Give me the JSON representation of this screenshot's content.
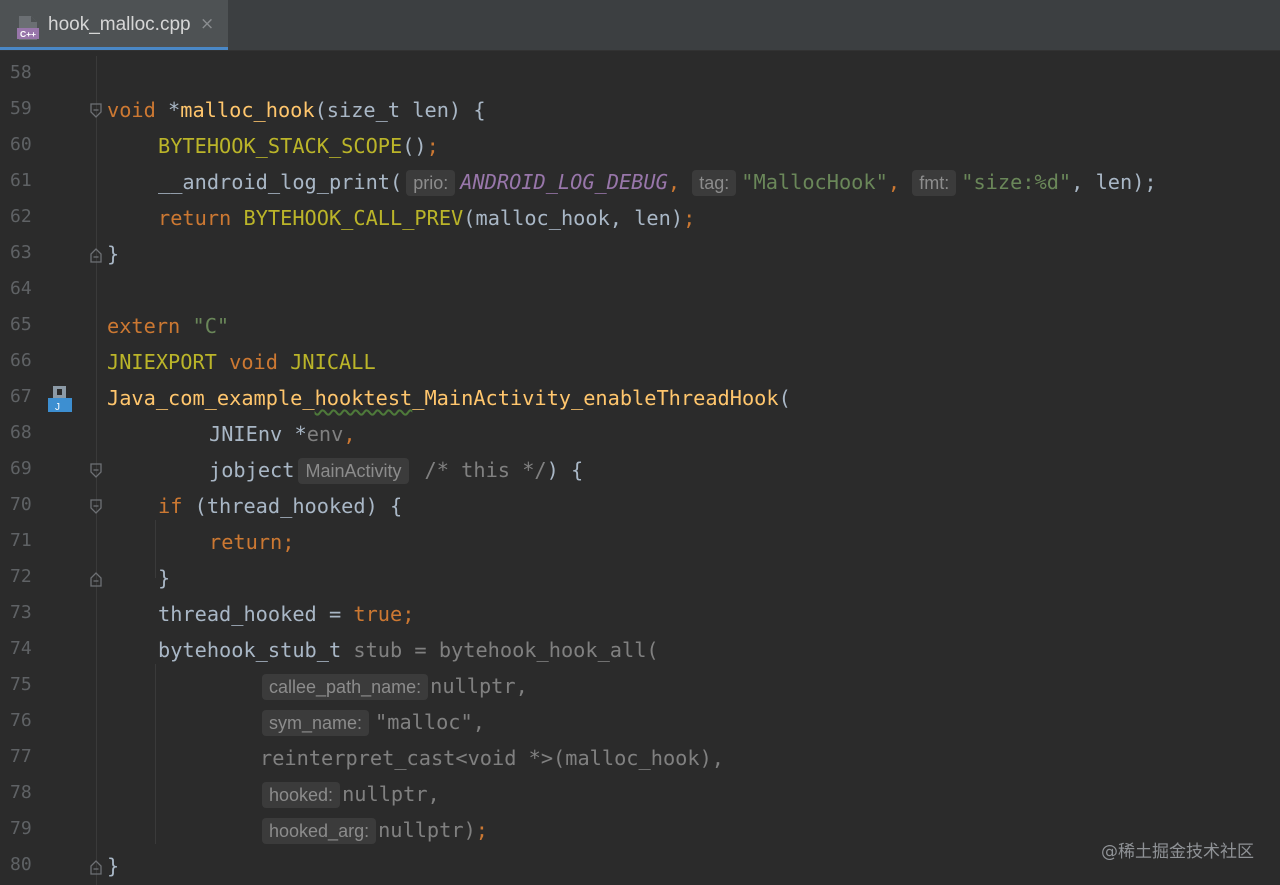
{
  "tab": {
    "filename": "hook_malloc.cpp",
    "icon": "cpp-file-icon",
    "icon_text": "C++",
    "close": "×"
  },
  "watermark": "@稀土掘金技术社区",
  "gutter_icon_text": "J",
  "lines": {
    "58": "58",
    "59": "59",
    "60": "60",
    "61": "61",
    "62": "62",
    "63": "63",
    "64": "64",
    "65": "65",
    "66": "66",
    "67": "67",
    "68": "68",
    "69": "69",
    "70": "70",
    "71": "71",
    "72": "72",
    "73": "73",
    "74": "74",
    "75": "75",
    "76": "76",
    "77": "77",
    "78": "78",
    "79": "79",
    "80": "80"
  },
  "code": {
    "l59": {
      "a": "void",
      "b": " *",
      "c": "malloc_hook",
      "d": "(size_t len) {"
    },
    "l60": {
      "a": "BYTEHOOK_STACK_SCOPE",
      "b": "()",
      "c": ";"
    },
    "l61": {
      "a": "__android_log_print(",
      "h1": "prio:",
      "b": "ANDROID_LOG_DEBUG",
      "c": ",",
      "h2": "tag:",
      "d": "\"MallocHook\"",
      "e": ",",
      "h3": "fmt:",
      "f": "\"size:%d\"",
      "g": ", len);"
    },
    "l62": {
      "a": "return",
      "b": " ",
      "c": "BYTEHOOK_CALL_PREV",
      "d": "(malloc_hook, len)",
      "e": ";"
    },
    "l63": {
      "a": "}"
    },
    "l65": {
      "a": "extern",
      "b": " ",
      "c": "\"C\""
    },
    "l66": {
      "a": "JNIEXPORT",
      "b": " ",
      "c": "void",
      "d": " ",
      "e": "JNICALL"
    },
    "l67": {
      "a": "Java_com_example_",
      "b": "hooktest",
      "c": "_MainActivity_enableThreadHook",
      "d": "("
    },
    "l68": {
      "a": "JNIEnv *",
      "b": "env",
      "c": ","
    },
    "l69": {
      "a": "jobject",
      "h": "MainActivity",
      "b": "/* this */",
      "c": ") {"
    },
    "l70": {
      "a": "if",
      "b": " (thread_hooked) {"
    },
    "l71": {
      "a": "return;"
    },
    "l72": {
      "a": "}"
    },
    "l73": {
      "a": "thread_hooked = ",
      "b": "true",
      "c": ";"
    },
    "l74": {
      "a": "bytehook_stub_t",
      "b": " stub = bytehook_hook_all("
    },
    "l75": {
      "h": "callee_path_name:",
      "a": "nullptr",
      "b": ","
    },
    "l76": {
      "h": "sym_name:",
      "a": "\"malloc\"",
      "b": ","
    },
    "l77": {
      "a": "reinterpret_cast<void *>(malloc_hook),"
    },
    "l78": {
      "h": "hooked:",
      "a": "nullptr",
      "b": ","
    },
    "l79": {
      "h": "hooked_arg:",
      "a": "nullptr",
      "b": ")",
      "c": ";"
    },
    "l80": {
      "a": "}"
    }
  }
}
